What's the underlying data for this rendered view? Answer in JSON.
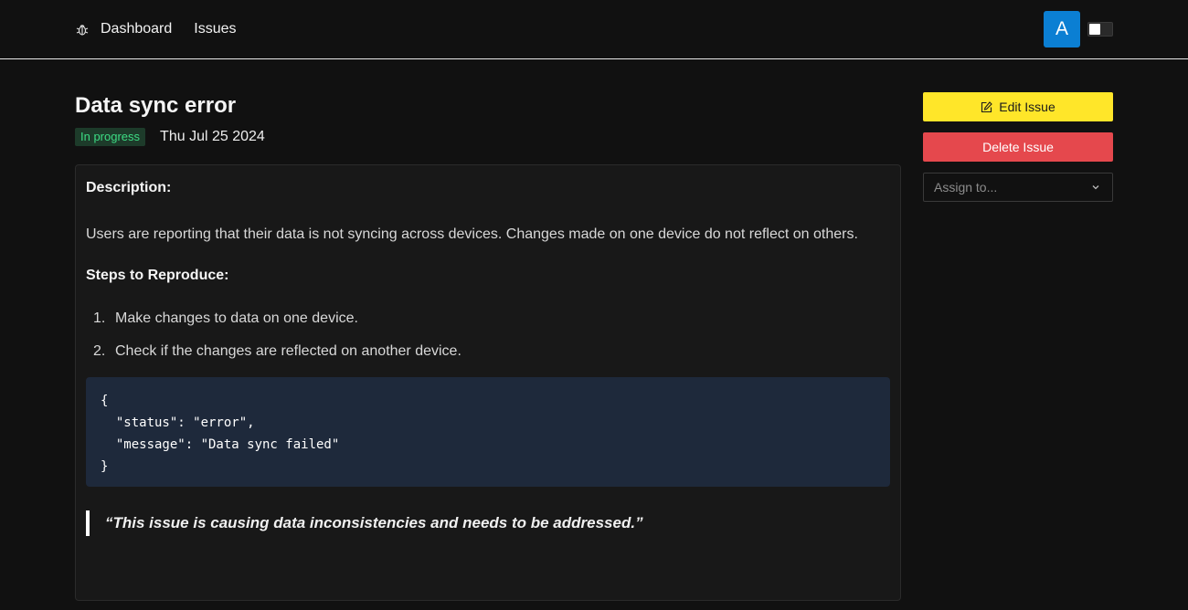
{
  "nav": {
    "logo_icon": "bug-icon",
    "links": [
      "Dashboard",
      "Issues"
    ],
    "avatar_letter": "A",
    "avatar_color": "#0b7fd3"
  },
  "issue": {
    "title": "Data sync error",
    "status": "In progress",
    "status_color": "#3ddc84",
    "date": "Thu Jul 25 2024",
    "description_heading": "Description:",
    "description": "Users are reporting that their data is not syncing across devices. Changes made on one device do not reflect on others.",
    "steps_heading": "Steps to Reproduce:",
    "steps": [
      {
        "num": "1.",
        "text": "Make changes to data on one device."
      },
      {
        "num": "2.",
        "text": "Check if the changes are reflected on another device."
      }
    ],
    "code_lines": [
      "{",
      "  \"status\": \"error\",",
      "  \"message\": \"Data sync failed\"",
      "}"
    ],
    "quote": "“This issue is causing data inconsistencies and needs to be addressed.”"
  },
  "sidebar": {
    "edit_label": "Edit Issue",
    "edit_color": "#ffe629",
    "delete_label": "Delete Issue",
    "delete_color": "#e5484d",
    "assign_placeholder": "Assign to..."
  }
}
